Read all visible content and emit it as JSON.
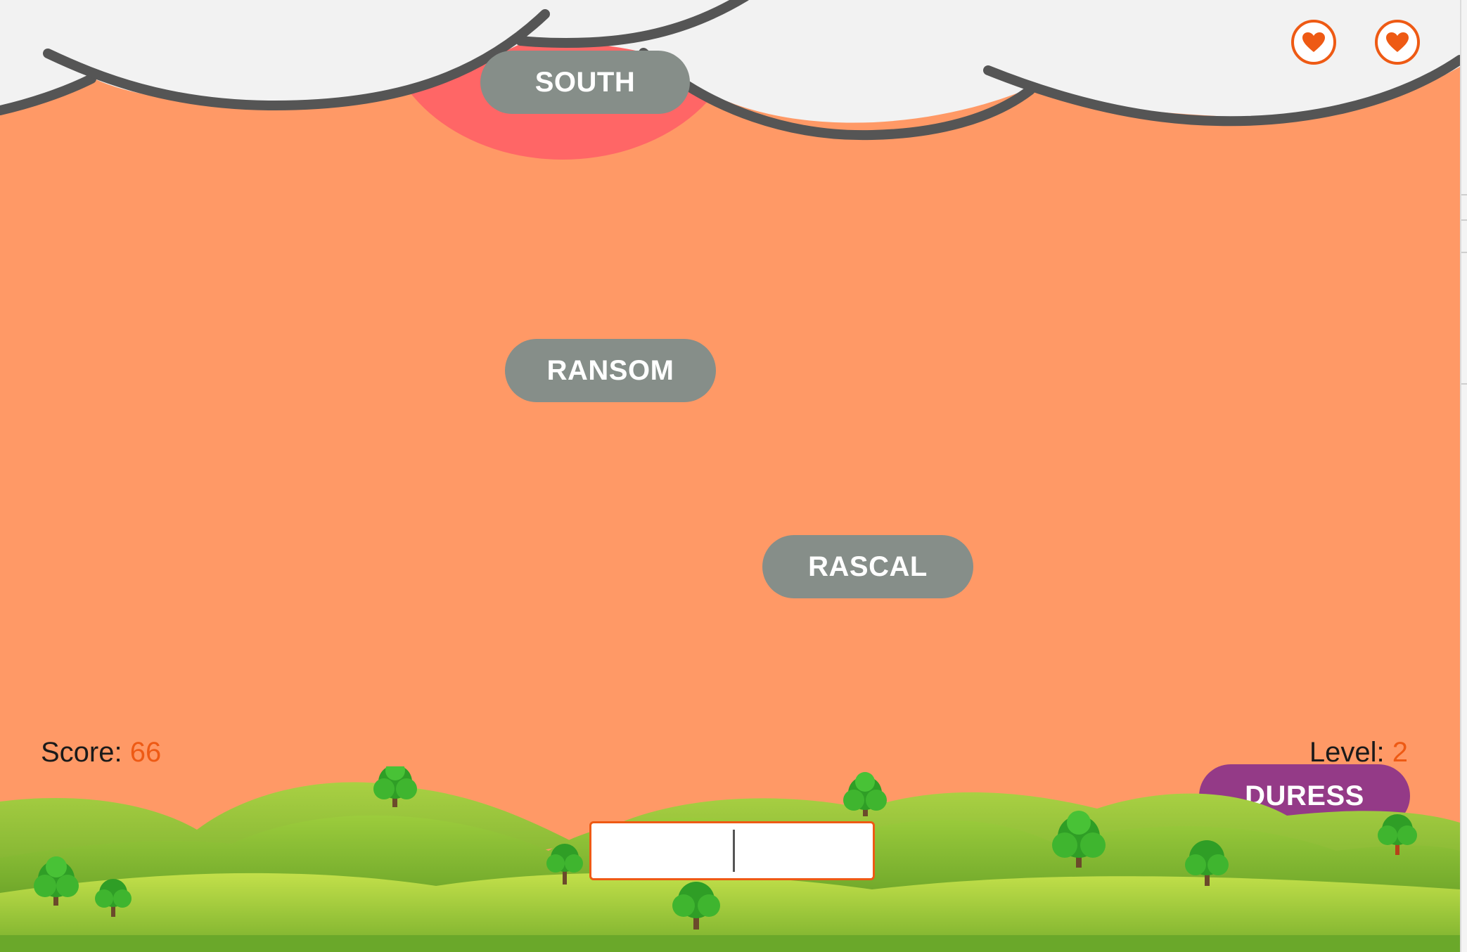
{
  "hud": {
    "score_label": "Score:",
    "score_value": "66",
    "level_label": "Level:",
    "level_value": "2"
  },
  "lives": {
    "count": 2,
    "icon": "heart-icon"
  },
  "falling_words": [
    {
      "text": "SOUTH",
      "state": "falling"
    },
    {
      "text": "RANSOM",
      "state": "falling"
    },
    {
      "text": "RASCAL",
      "state": "falling"
    },
    {
      "text": "DURESS",
      "state": "active"
    }
  ],
  "input": {
    "value": "",
    "placeholder": ""
  },
  "colors": {
    "sky": "#ff9966",
    "sun": "#ff6666",
    "word_bubble": "#868e89",
    "active_word_bubble": "#943a87",
    "accent": "#ee5a14",
    "cloud": "#f2f2f2",
    "cloud_outline": "#555555",
    "grass": "#8ec63f"
  }
}
